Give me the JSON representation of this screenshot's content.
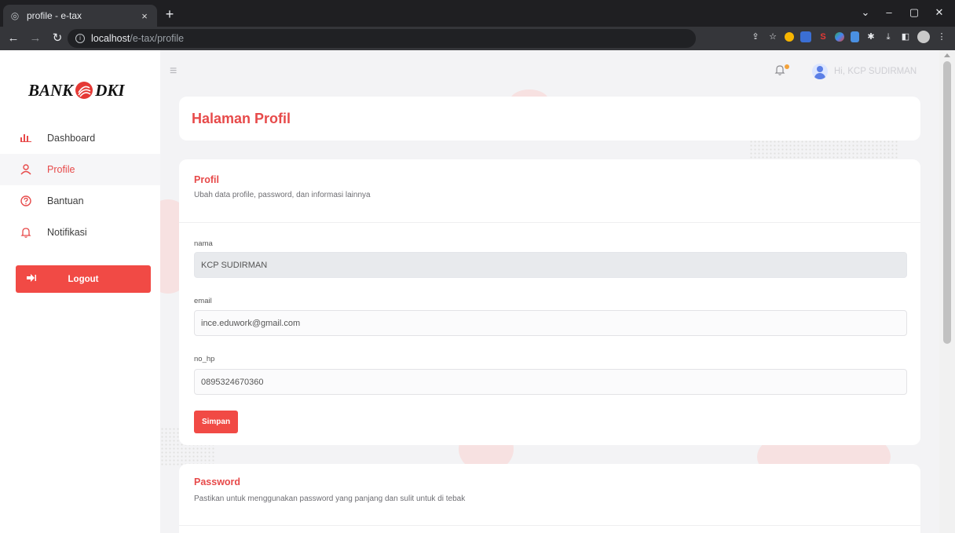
{
  "browser": {
    "tab_title": "profile - e-tax",
    "tab_close": "×",
    "new_tab": "+",
    "url_host": "localhost",
    "url_path": "/e-tax/profile"
  },
  "brand": {
    "logo_left": "BANK",
    "logo_right": "DKI"
  },
  "sidebar": {
    "items": [
      {
        "label": "Dashboard",
        "icon": "bar-chart-icon"
      },
      {
        "label": "Profile",
        "icon": "user-icon",
        "active": true
      },
      {
        "label": "Bantuan",
        "icon": "help-icon"
      },
      {
        "label": "Notifikasi",
        "icon": "bell-icon"
      }
    ],
    "logout_label": "Logout"
  },
  "topbar": {
    "user_greeting": "Hi, KCP SUDIRMAN"
  },
  "page": {
    "title": "Halaman Profil"
  },
  "profile_section": {
    "title": "Profil",
    "description": "Ubah data profile, password, dan informasi lainnya",
    "fields": {
      "nama": {
        "label": "nama",
        "value": "KCP SUDIRMAN"
      },
      "email": {
        "label": "email",
        "value": "ince.eduwork@gmail.com"
      },
      "no_hp": {
        "label": "no_hp",
        "value": "0895324670360"
      }
    },
    "save_label": "Simpan"
  },
  "password_section": {
    "title": "Password",
    "description": "Pastikan untuk menggunakan password yang panjang dan sulit untuk di tebak"
  },
  "colors": {
    "accent": "#e74a4a",
    "button": "#f14a45",
    "notification_dot": "#f3a23b"
  }
}
